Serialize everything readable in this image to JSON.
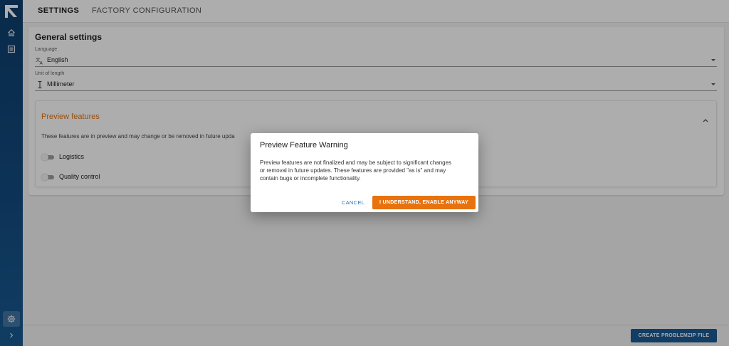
{
  "app": {
    "tabs": [
      {
        "label": "SETTINGS",
        "active": true
      },
      {
        "label": "FACTORY CONFIGURATION",
        "active": false
      }
    ]
  },
  "sidebar": {
    "items": [
      {
        "icon": "home-icon"
      },
      {
        "icon": "list-icon"
      },
      {
        "icon": "gear-icon"
      },
      {
        "icon": "chevron-right-icon"
      }
    ]
  },
  "general": {
    "title": "General settings",
    "language": {
      "label": "Language",
      "value": "English",
      "icon": "translate-icon"
    },
    "unit": {
      "label": "Unit of length",
      "value": "Millimeter",
      "icon": "ruler-icon"
    }
  },
  "preview": {
    "title": "Preview features",
    "description": "These features are in preview and may change or be removed in future upda",
    "toggles": [
      {
        "label": "Logistics",
        "on": false
      },
      {
        "label": "Quality control",
        "on": false
      }
    ]
  },
  "footer": {
    "problemzip_label": "CREATE PROBLEMZIP FILE"
  },
  "dialog": {
    "title": "Preview Feature Warning",
    "body_lines": [
      "Preview features are not finalized and may be subject to significant changes",
      "or removal in future updates. These features are provided \"as is\" and may",
      "contain bugs or incomplete functionality."
    ],
    "cancel_label": "CANCEL",
    "confirm_label": "I UNDERSTAND, ENABLE ANYWAY"
  },
  "colors": {
    "accent": "#e8730e",
    "primary": "#1b5a94",
    "sidebar": "#134b80"
  }
}
